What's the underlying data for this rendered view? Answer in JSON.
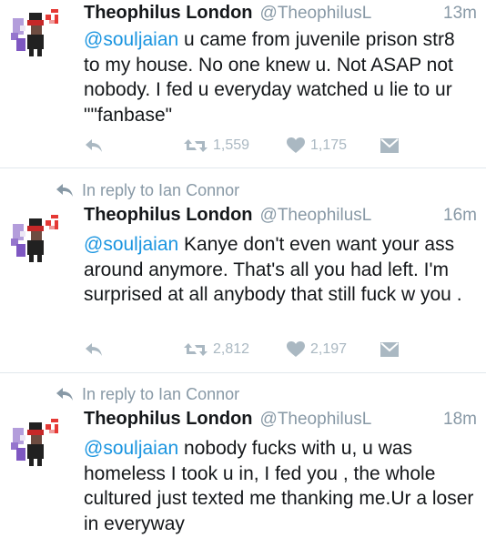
{
  "tweets": [
    {
      "reply_context": "",
      "name": "Theophilus London",
      "handle": "@TheophilusL",
      "time": "13m",
      "mention": "@souljaian",
      "body": " u came from juvenile prison str8 to my house. No one knew u. Not ASAP not nobody. I fed u everyday watched u lie to ur \"\"fanbase\"",
      "retweets": "1,559",
      "likes": "1,175"
    },
    {
      "reply_context": "In reply to Ian Connor",
      "name": "Theophilus London",
      "handle": "@TheophilusL",
      "time": "16m",
      "mention": "@souljaian",
      "body": " Kanye don't even want your ass around anymore. That's all you had left. I'm surprised at all anybody that still fuck w you .",
      "retweets": "2,812",
      "likes": "2,197"
    },
    {
      "reply_context": "In reply to Ian Connor",
      "name": "Theophilus London",
      "handle": "@TheophilusL",
      "time": "18m",
      "mention": "@souljaian",
      "body": " nobody fucks with u, u was homeless I took u in, I fed you , the whole cultured just texted me thanking me.Ur a loser in everyway"
    }
  ],
  "icons": {
    "reply": "reply-arrow-icon",
    "retweet": "retweet-icon",
    "like": "heart-icon",
    "message": "envelope-icon",
    "avatar": "pixel-art-avatar"
  },
  "colors": {
    "mention": "#1b95e0",
    "muted": "#8899a6",
    "action": "#aab8c2",
    "divider": "#e1e8ed"
  }
}
